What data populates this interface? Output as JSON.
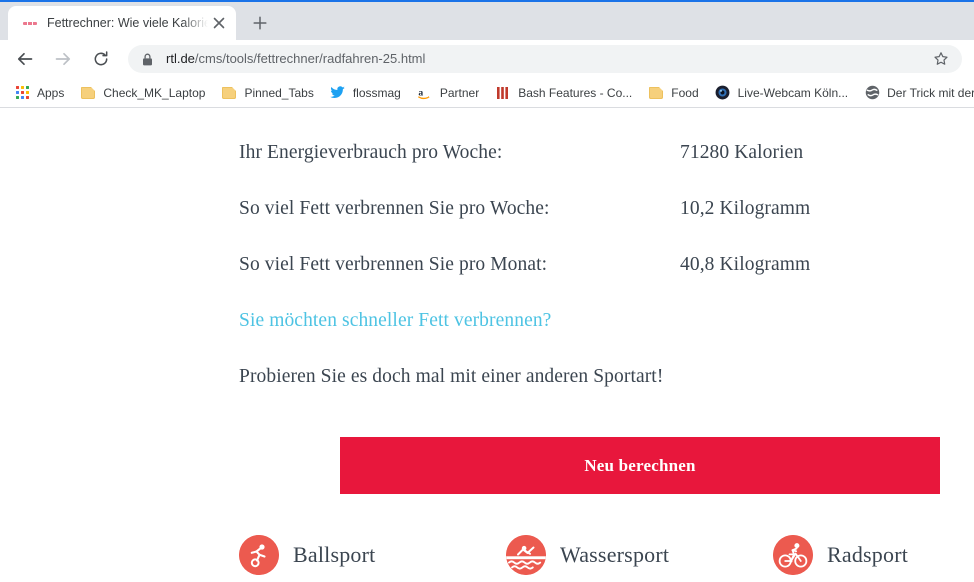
{
  "browser": {
    "tab": {
      "title": "Fettrechner: Wie viele Kalorien ve",
      "favicon": "dashes-favicon",
      "close_label": "close-icon"
    },
    "new_tab_label": "+",
    "nav": {
      "back": "back-arrow-icon",
      "forward": "forward-arrow-icon",
      "reload": "reload-icon"
    },
    "omnibox": {
      "lock": "lock-icon",
      "url_domain": "rtl.de",
      "url_path": "/cms/tools/fettrechner/radfahren-25.html",
      "url_full": "rtl.de/cms/tools/fettrechner/radfahren-25.html",
      "star": "star-icon"
    },
    "bookmarks": [
      {
        "label": "Apps",
        "icon": "apps-grid-icon"
      },
      {
        "label": "Check_MK_Laptop",
        "icon": "folder-icon"
      },
      {
        "label": "Pinned_Tabs",
        "icon": "folder-icon"
      },
      {
        "label": "flossmag",
        "icon": "twitter-icon"
      },
      {
        "label": "Partner",
        "icon": "amazon-icon"
      },
      {
        "label": "Bash Features - Co...",
        "icon": "bars-icon"
      },
      {
        "label": "Food",
        "icon": "folder-icon"
      },
      {
        "label": "Live-Webcam Köln...",
        "icon": "camera-icon"
      },
      {
        "label": "Der Trick mit der",
        "icon": "globe-icon"
      }
    ]
  },
  "page": {
    "results": [
      {
        "label": "Ihr Energieverbrauch pro Woche:",
        "value": "71280 Kalorien"
      },
      {
        "label": "So viel Fett verbrennen Sie pro Woche:",
        "value": "10,2 Kilogramm"
      },
      {
        "label": "So viel Fett verbrennen Sie pro Monat:",
        "value": "40,8 Kilogramm"
      }
    ],
    "promo_link": "Sie möchten schneller Fett verbrennen?",
    "promo_text": "Probieren Sie es doch mal mit einer anderen Sportart!",
    "recalculate_button": "Neu berechnen",
    "sports": [
      {
        "label": "Ballsport",
        "icon": "soccer-player-icon"
      },
      {
        "label": "Wassersport",
        "icon": "swimmer-icon"
      },
      {
        "label": "Radsport",
        "icon": "cyclist-icon"
      }
    ],
    "colors": {
      "accent_red": "#e8173c",
      "link_cyan": "#4dc3e3",
      "icon_red": "#ec5a4f",
      "text": "#3b4550"
    }
  }
}
